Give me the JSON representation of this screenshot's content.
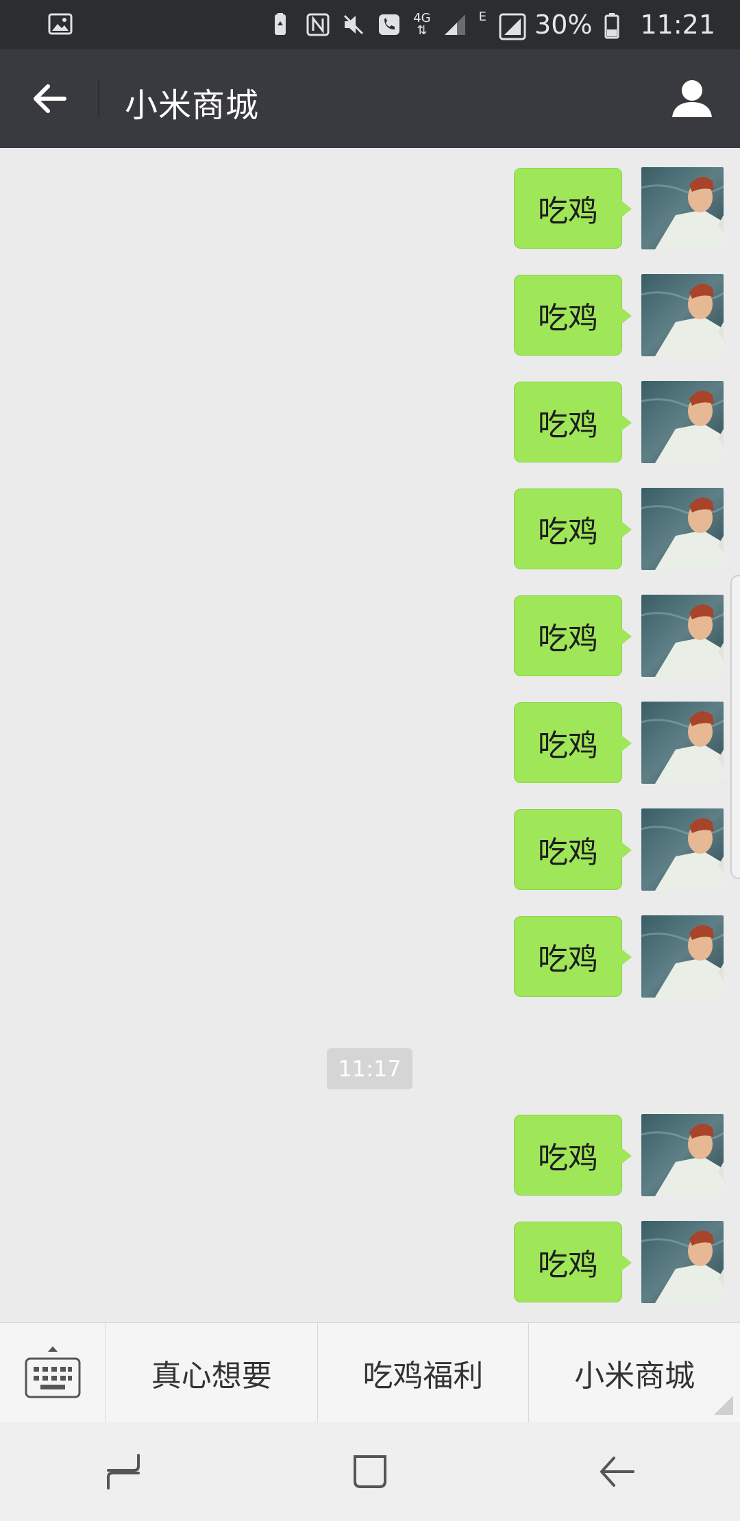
{
  "status_bar": {
    "network": "4G",
    "network_type": "E",
    "battery": "30%",
    "time": "11:21",
    "icons": [
      "image-icon",
      "battery-saver-icon",
      "nfc-icon",
      "mute-icon",
      "call-icon",
      "signal-icon",
      "battery-icon"
    ]
  },
  "header": {
    "title": "小米商城",
    "back_icon": "arrow-left-icon",
    "profile_icon": "person-icon"
  },
  "messages": [
    {
      "text": "吃鸡"
    },
    {
      "text": "吃鸡"
    },
    {
      "text": "吃鸡"
    },
    {
      "text": "吃鸡"
    },
    {
      "text": "吃鸡"
    },
    {
      "text": "吃鸡"
    },
    {
      "text": "吃鸡"
    },
    {
      "text": "吃鸡"
    },
    {
      "text": "吃鸡"
    },
    {
      "text": "吃鸡"
    }
  ],
  "timestamp": "11:17",
  "menu": {
    "keyboard_icon": "keyboard-icon",
    "items": [
      "真心想要",
      "吃鸡福利",
      "小米商城"
    ]
  },
  "nav": {
    "recent_icon": "recent-apps-icon",
    "home_icon": "home-icon",
    "back_icon": "back-icon"
  },
  "colors": {
    "bubble": "#9fe658",
    "header": "#393a3f",
    "background": "#ebebeb"
  }
}
